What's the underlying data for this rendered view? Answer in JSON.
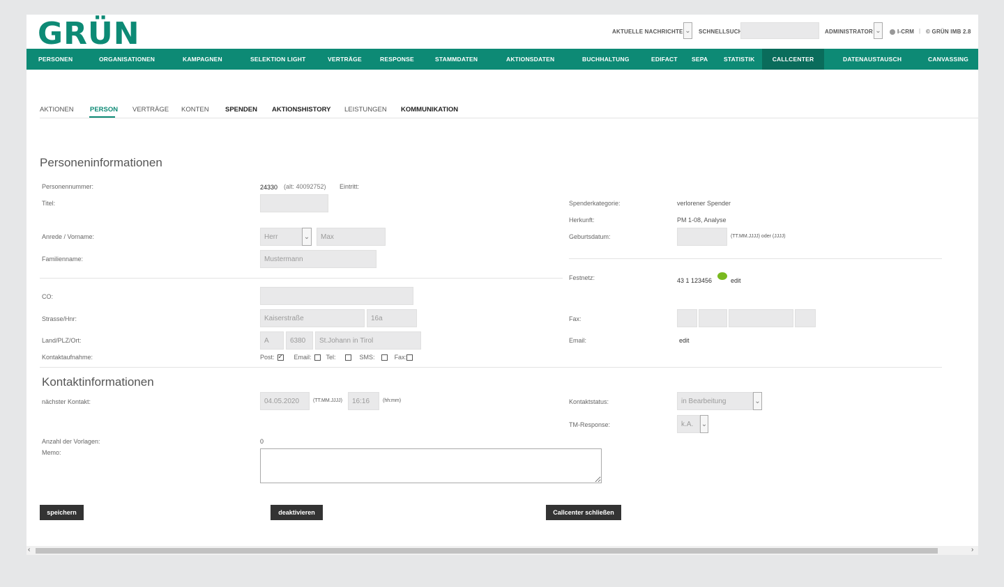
{
  "header": {
    "logo": "GRÜN",
    "aktuelle_nachrichten": "AKTUELLE NACHRICHTEN",
    "schnellsuche": "SCHNELLSUCHE:",
    "schnellsuche_value": "",
    "user": "ADMINISTRATOR",
    "icrm": "I-CRM",
    "separator": "|",
    "copyright": "© GRÜN IMB 2.8"
  },
  "nav": {
    "items": [
      "PERSONEN",
      "ORGANISATIONEN",
      "KAMPAGNEN",
      "SELEKTION LIGHT",
      "VERTRÄGE",
      "RESPONSE",
      "STAMMDATEN",
      "AKTIONSDATEN",
      "BUCHHALTUNG",
      "EDIFACT",
      "SEPA",
      "STATISTIK",
      "CALLCENTER",
      "DATENAUSTAUSCH",
      "CANVASSING"
    ],
    "active": "CALLCENTER"
  },
  "tabs": [
    "AKTIONEN",
    "PERSON",
    "VERTRÄGE",
    "KONTEN",
    "SPENDEN",
    "AKTIONSHISTORY",
    "LEISTUNGEN",
    "KOMMUNIKATION"
  ],
  "person": {
    "section_title": "Personeninformationen",
    "personennummer_label": "Personennummer:",
    "personennummer": "24330",
    "alt": "(alt: 40092752)",
    "eintritt_label": "Eintritt:",
    "titel_label": "Titel:",
    "titel_value": "",
    "anrede_label": "Anrede / Vorname:",
    "anrede": "Herr",
    "vorname": "Max",
    "familienname_label": "Familienname:",
    "familienname": "Mustermann",
    "co_label": "CO:",
    "co_value": "",
    "strasse_label": "Strasse/Hnr:",
    "strasse": "Kaiserstraße",
    "hnr": "16a",
    "land_label": "Land/PLZ/Ort:",
    "land": "A",
    "plz": "6380",
    "ort": "St.Johann in Tirol",
    "kontaktaufnahme_label": "Kontaktaufnahme:",
    "kontakt_post": "Post:",
    "kontakt_email": "Email:",
    "kontakt_tel": "Tel:",
    "kontakt_sms": "SMS:",
    "kontakt_fax": "Fax:",
    "kontakt_checked": {
      "post": true,
      "email": false,
      "tel": false,
      "sms": false,
      "fax": false
    }
  },
  "right": {
    "spenderkategorie_label": "Spenderkategorie:",
    "spenderkategorie": "verlorener Spender",
    "herkunft_label": "Herkunft:",
    "herkunft": "PM 1-08, Analyse",
    "geburtsdatum_label": "Geburtsdatum:",
    "geburtsdatum_value": "",
    "geburtsdatum_hint": "(TT.MM.JJJJ) oder (JJJJ)",
    "festnetz_label": "Festnetz:",
    "festnetz": "43 1 123456",
    "edit": "edit",
    "fax_label": "Fax:",
    "email_label": "Email:",
    "email_edit": "edit"
  },
  "kontakt": {
    "section_title": "Kontaktinformationen",
    "naechster_label": "nächster Kontakt:",
    "datum": "04.05.2020",
    "datum_hint": "(TT.MM.JJJJ)",
    "zeit": "16:16",
    "zeit_hint": "(hh:mm)",
    "status_label": "Kontaktstatus:",
    "status": "in Bearbeitung",
    "tm_label": "TM-Response:",
    "tm": "k.A.",
    "vorlagen_label": "Anzahl der Vorlagen:",
    "vorlagen": "0",
    "memo_label": "Memo:",
    "memo": ""
  },
  "buttons": {
    "speichern": "speichern",
    "deaktivieren": "deaktivieren",
    "callcenter_schliessen": "Callcenter schließen"
  },
  "colors": {
    "brand": "#0d8a75",
    "nav_active": "#0a6c5b",
    "button": "#333333"
  }
}
